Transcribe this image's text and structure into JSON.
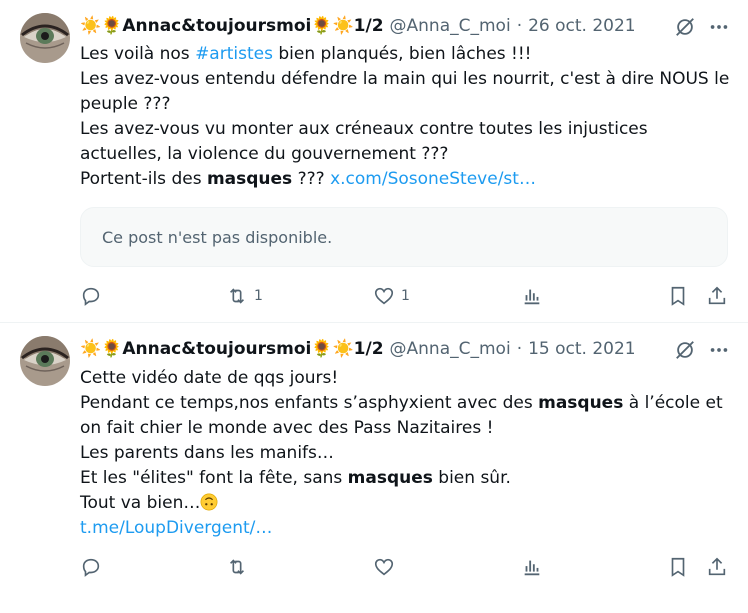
{
  "tweets": [
    {
      "name_prefix": "☀️🌻",
      "name_core": "Annac&toujoursmoi",
      "name_suffix": "🌻☀️1/2",
      "handle": "@Anna_C_moi",
      "dot": "·",
      "date": "26 oct. 2021",
      "lines": [
        {
          "before": "Les voilà nos ",
          "hashtag": "#artistes",
          "after": " bien planqués, bien lâches !!!"
        },
        {
          "text": "Les avez-vous entendu défendre la main qui les nourrit, c'est à dire NOUS le"
        },
        {
          "text": "peuple ???"
        },
        {
          "text": "Les avez-vous vu monter aux créneaux contre toutes les injustices"
        },
        {
          "text": "actuelles, la violence du gouvernement ???"
        },
        {
          "before": "Portent-ils des ",
          "bold": "masques",
          "after": " ??? ",
          "link": "x.com/SosoneSteve/st…"
        }
      ],
      "quote_unavailable": "Ce post n'est pas disponible.",
      "actions": {
        "reply": "",
        "repost": "1",
        "like": "1"
      }
    },
    {
      "name_prefix": "☀️🌻",
      "name_core": "Annac&toujoursmoi",
      "name_suffix": "🌻☀️1/2",
      "handle": "@Anna_C_moi",
      "dot": "·",
      "date": "15 oct. 2021",
      "lines": [
        {
          "text": "Cette vidéo date de qqs jours!"
        },
        {
          "before": "Pendant ce temps,nos enfants s’asphyxient avec des ",
          "bold": "masques",
          "after": " à l’école et"
        },
        {
          "text": "on fait chier le monde avec des Pass Nazitaires !"
        },
        {
          "text": "Les parents dans les manifs…"
        },
        {
          "before": "Et les \"élites\" font la fête, sans ",
          "bold": "masques",
          "after": " bien sûr."
        },
        {
          "text": "Tout va bien…"
        },
        {
          "link": "t.me/LoupDivergent/…"
        }
      ],
      "actions": {
        "reply": "",
        "repost": "",
        "like": ""
      }
    }
  ],
  "colors": {
    "link": "#1d9bf0",
    "secondary": "#536471",
    "text": "#0f1419"
  },
  "icons": [
    "reply-icon",
    "repost-icon",
    "like-icon",
    "views-icon",
    "bookmark-icon",
    "share-icon",
    "grok-icon",
    "more-icon",
    "upside-down-face-emoji"
  ]
}
